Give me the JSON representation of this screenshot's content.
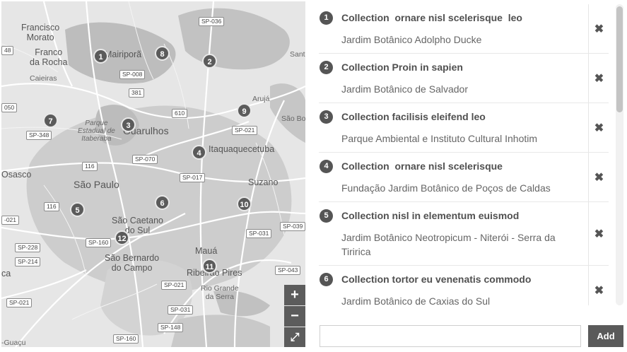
{
  "map": {
    "places": {
      "francisco_morato": "Francisco\nMorato",
      "franco_da_rocha": "Franco\nda Rocha",
      "mairipora": "Mairiporã",
      "caieiras": "Caieiras",
      "parque_estadual": "Parque\nEstadual de\nItaberaba",
      "guarulhos": "Guarulhos",
      "aruja": "Arujá",
      "sao_bo": "São Bo",
      "sant": "Sant",
      "itaquaquecetuba": "Itaquaquecetuba",
      "osasco": "Osasco",
      "sao_paulo": "São Paulo",
      "suzano": "Suzano",
      "sao_caetano": "São Caetano\ndo Sul",
      "maua": "Mauá",
      "sao_bernardo": "São Bernardo\ndo Campo",
      "ribeirao_pires": "Ribeirão Pires",
      "rio_grande": "Rio Grande\nda Serra",
      "ca": "ca",
      "guacu": "-Guaçu"
    },
    "roads": {
      "sp036": "SP-036",
      "r48": "48",
      "sp008": "SP-008",
      "r381": "381",
      "r050": "050",
      "r610": "610",
      "sp348": "SP-348",
      "sp021_ne": "SP-021",
      "sp070": "SP-070",
      "r116_n": "116",
      "sp017": "SP-017",
      "r116_w": "116",
      "r021_w": "-021",
      "sp039": "SP-039",
      "sp031_e": "SP-031",
      "sp160_c": "SP-160",
      "sp228": "SP-228",
      "sp214": "SP-214",
      "sp043": "SP-043",
      "sp021_s": "SP-021",
      "sp031_s": "SP-031",
      "sp021_sw": "SP-021",
      "sp148": "SP-148",
      "sp160_s": "SP-160"
    },
    "pins": [
      "1",
      "2",
      "3",
      "4",
      "5",
      "6",
      "7",
      "8",
      "9",
      "10",
      "11",
      "12"
    ],
    "zoom_in": "+",
    "zoom_out": "−",
    "fullscreen": "⤢"
  },
  "collections": [
    {
      "num": "1",
      "title": "Collection  ornare nisl scelerisque  leo",
      "location": "Jardim Botânico Adolpho Ducke"
    },
    {
      "num": "2",
      "title": "Collection Proin in sapien",
      "location": "Jardim Botânico de Salvador"
    },
    {
      "num": "3",
      "title": "Collection facilisis eleifend leo",
      "location": "Parque Ambiental e Instituto Cultural Inhotim"
    },
    {
      "num": "4",
      "title": "Collection  ornare nisl scelerisque",
      "location": "Fundação Jardim Botânico de Poços de Caldas"
    },
    {
      "num": "5",
      "title": "Collection nisl in elementum euismod",
      "location": "Jardim Botânico Neotropicum - Niterói - Serra da Tiririca"
    },
    {
      "num": "6",
      "title": "Collection tortor eu venenatis commodo",
      "location": "Jardim Botânico de Caxias do Sul"
    }
  ],
  "delete_icon": "✖",
  "add": {
    "value": "",
    "button": "Add"
  }
}
